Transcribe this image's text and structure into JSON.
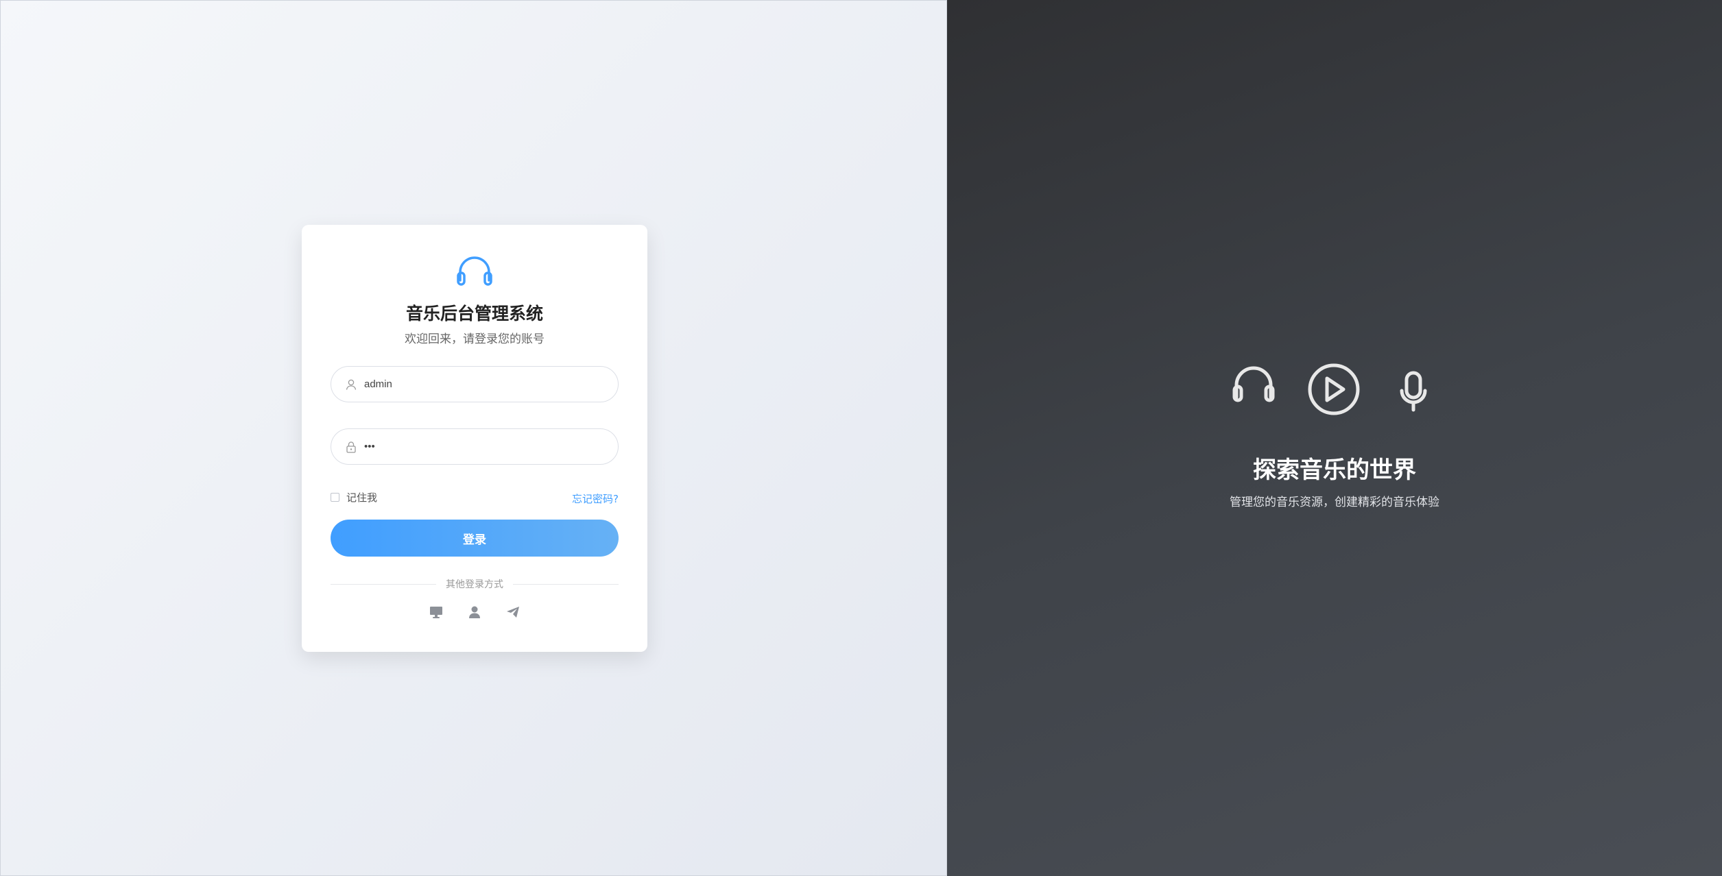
{
  "app": {
    "title": "音乐后台管理系统",
    "subtitle": "欢迎回来，请登录您的账号"
  },
  "form": {
    "username_value": "admin",
    "password_value": "•••",
    "remember_label": "记住我",
    "forgot_label": "忘记密码?",
    "login_label": "登录",
    "other_login_label": "其他登录方式"
  },
  "social_icons": [
    "desktop-icon",
    "user-icon",
    "paper-plane-icon"
  ],
  "hero": {
    "title": "探索音乐的世界",
    "subtitle": "管理您的音乐资源，创建精彩的音乐体验",
    "icons": [
      "headphones-icon",
      "play-circle-icon",
      "microphone-icon"
    ]
  },
  "colors": {
    "primary": "#409eff",
    "dark_bg": "#3f4349",
    "light_bg": "#eef1f6"
  }
}
